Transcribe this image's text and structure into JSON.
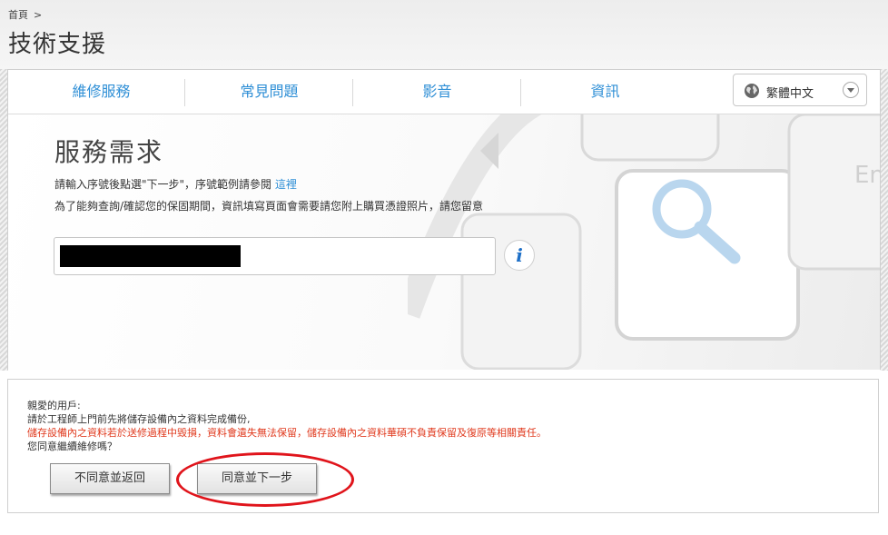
{
  "breadcrumb": {
    "home": "首頁",
    "separator": ">"
  },
  "page_title": "技術支援",
  "tabs": [
    {
      "label": "維修服務"
    },
    {
      "label": "常見問題"
    },
    {
      "label": "影音"
    },
    {
      "label": "資訊"
    }
  ],
  "language": {
    "label": "繁體中文",
    "icon": "globe-icon"
  },
  "service": {
    "title": "服務需求",
    "instruction_prefix": "請輸入序號後點選\"下一步\"，序號範例請參閱 ",
    "instruction_link": "這裡",
    "warranty_note": "為了能夠查詢/確認您的保固期間，資訊填寫頁面會需要請您附上購買憑證照片，請您留意",
    "serial_value": "",
    "info_icon": "info-icon"
  },
  "notice": {
    "greeting": "親愛的用戶:",
    "line_backup": "請於工程師上門前先將儲存設備內之資料完成備份,",
    "line_warning": "儲存設備內之資料若於送修過程中毀損，資料會遺失無法保留，儲存設備內之資料華碩不負責保留及復原等相關責任。",
    "line_question": "您同意繼續維修嗎？",
    "disagree_label": "不同意並返回",
    "agree_label": "同意並下一步"
  },
  "colors": {
    "accent": "#2f8fd6",
    "warning": "#e03a1e",
    "annotation": "#e0141b"
  }
}
